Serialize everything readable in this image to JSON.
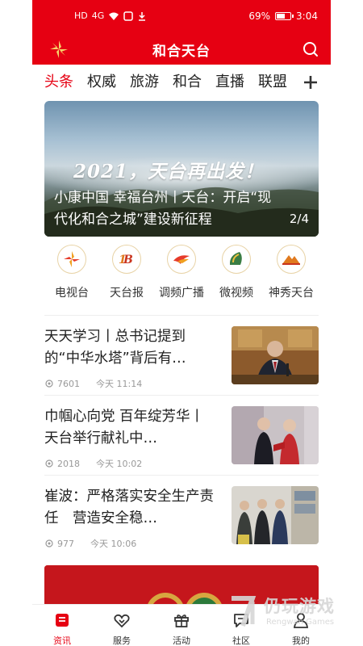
{
  "status_bar": {
    "left_icons": [
      "HD",
      "4G",
      "wifi-icon",
      "sim-icon",
      "download-icon"
    ],
    "battery_percent": "69%",
    "battery_level": 0.69,
    "time": "3:04"
  },
  "header": {
    "title": "和合天台",
    "logo_icon": "app-logo-icon",
    "search_icon": "search-icon"
  },
  "tabs": {
    "items": [
      "头条",
      "权威",
      "旅游",
      "和合",
      "直播",
      "联盟"
    ],
    "active": "头条",
    "add_icon": "plus-icon"
  },
  "banner": {
    "slogan": "2021，天台再出发！",
    "caption": "小康中国 幸福台州丨天台：开启“现代化和合之城”建设新征程",
    "counter": "2/4"
  },
  "channels": [
    {
      "label": "电视台",
      "icon": "tv-station-icon"
    },
    {
      "label": "天台报",
      "icon": "newspaper-icon"
    },
    {
      "label": "调频广播",
      "icon": "radio-icon"
    },
    {
      "label": "微视频",
      "icon": "micro-video-icon"
    },
    {
      "label": "神秀天台",
      "icon": "mountain-icon"
    }
  ],
  "news": [
    {
      "title": "天天学习丨总书记提到的“中华水塔”背后有…",
      "views": "7601",
      "time": "今天 11:14",
      "view_icon": "eye-icon"
    },
    {
      "title": "巾帼心向党 百年绽芳华丨 天台举行献礼中…",
      "views": "2018",
      "time": "今天 10:02",
      "view_icon": "eye-icon"
    },
    {
      "title": "崔波：严格落实安全生产责任　营造安全稳…",
      "views": "977",
      "time": "今天 10:06",
      "view_icon": "eye-icon"
    }
  ],
  "tabbar": [
    {
      "label": "资讯",
      "icon": "news-tab-icon",
      "active": true
    },
    {
      "label": "服务",
      "icon": "service-tab-icon",
      "active": false
    },
    {
      "label": "活动",
      "icon": "gift-tab-icon",
      "active": false
    },
    {
      "label": "社区",
      "icon": "chat-tab-icon",
      "active": false
    },
    {
      "label": "我的",
      "icon": "profile-tab-icon",
      "active": false
    }
  ],
  "watermark": {
    "text": "仍玩游戏",
    "subtext": "Rengwan Games"
  },
  "colors": {
    "brand_red": "#e60012",
    "text_dark": "#222222",
    "meta_gray": "#999999"
  }
}
